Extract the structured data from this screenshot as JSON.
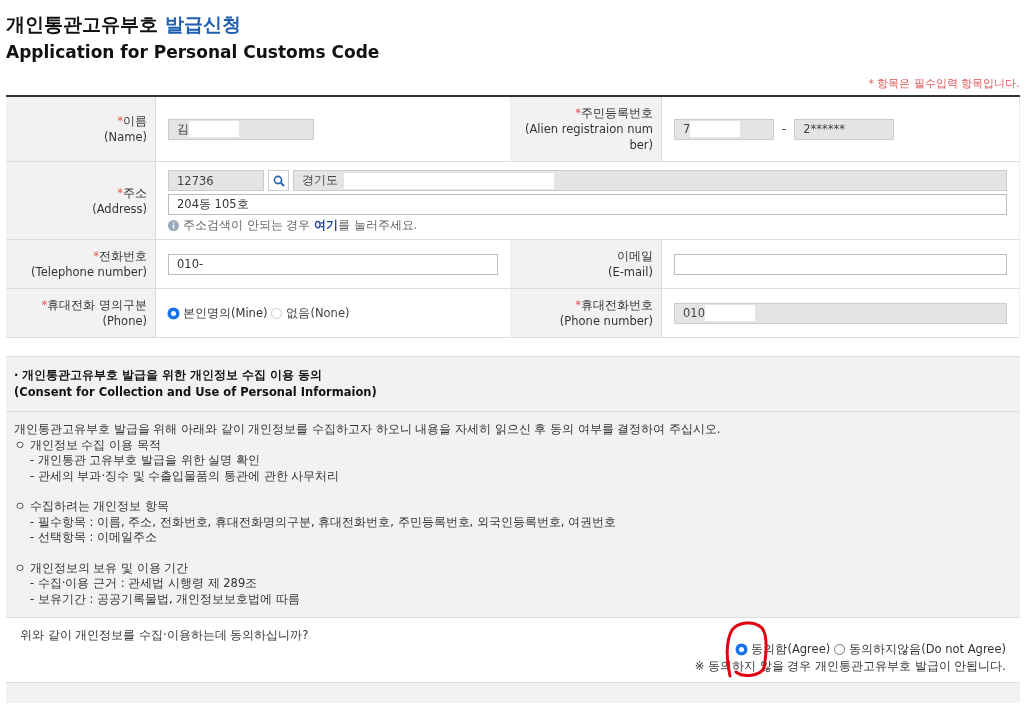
{
  "header": {
    "title": "개인통관고유부호",
    "title_highlight": "발급신청",
    "subtitle": "Application for Personal Customs Code",
    "required_note": "* 항목은 필수입력 항목입니다."
  },
  "form": {
    "required_mark": "*",
    "rows": [
      {
        "fields": [
          {
            "kind": "text",
            "label": "이름",
            "sublabel": "(Name)",
            "required": true,
            "value": "김",
            "readonly": true,
            "masked": true
          },
          {
            "kind": "id_number",
            "label": "주민등록번호",
            "sublabel": "(Alien registraion number)",
            "required": true,
            "parts": [
              {
                "value": "7",
                "masked": true
              },
              {
                "value": "2******",
                "masked": false
              }
            ],
            "separator": "-",
            "readonly": true
          }
        ]
      },
      {
        "fields": [
          {
            "kind": "address",
            "label": "주소",
            "sublabel": "(Address)",
            "required": true,
            "zip": "12736",
            "road": "경기도",
            "road_masked": true,
            "detail": "204동 105호",
            "hint_before": "주소검색이 안되는 경우 ",
            "hint_link": "여기",
            "hint_after": "를 눌러주세요."
          }
        ]
      },
      {
        "fields": [
          {
            "kind": "text",
            "label": "전화번호",
            "sublabel": "(Telephone number)",
            "required": true,
            "value": "010-",
            "readonly": false
          },
          {
            "kind": "text",
            "label": "이메일",
            "sublabel": "(E-mail)",
            "required": false,
            "readonly": false
          }
        ]
      },
      {
        "fields": [
          {
            "kind": "radio",
            "label": "휴대전화 명의구분",
            "sublabel": "(Phone)",
            "required": true,
            "options": [
              {
                "label": "본인명의(Mine)",
                "selected": true,
                "disabled": false
              },
              {
                "label": "없음(None)",
                "selected": false,
                "disabled": true
              }
            ]
          },
          {
            "kind": "text",
            "label": "휴대전화번호",
            "sublabel": "(Phone number)",
            "required": true,
            "value": "010",
            "readonly": true,
            "masked": true
          }
        ]
      }
    ]
  },
  "consent": {
    "heading": "· 개인통관고유부호 발급을 위한 개인정보 수집 이용 동의",
    "heading_en": "(Consent for Collection and Use of Personal Informaion)",
    "intro": "개인통관고유부호 발급을 위해 아래와 같이 개인정보를 수집하고자 하오니 내용을 자세히 읽으신 후 동의 여부를 결정하여 주십시오.",
    "sections": [
      {
        "title": "ㅇ 개인정보 수집 이용 목적",
        "items": [
          "- 개인통관 고유부호 발급을 위한 실명 확인",
          "- 관세의 부과·징수 및 수출입물품의 통관에 관한 사무처리"
        ]
      },
      {
        "title": "ㅇ 수집하려는 개인정보 항목",
        "items": [
          "- 필수항목 : 이름, 주소, 전화번호, 휴대전화명의구분, 휴대전화번호, 주민등록번호, 외국인등록번호, 여권번호",
          "- 선택항목 : 이메일주소"
        ]
      },
      {
        "title": "ㅇ 개인정보의 보유 및 이용 기간",
        "items": [
          "- 수집·이용 근거 : 관세법 시행령 제 289조",
          "- 보유기간 : 공공기록물법, 개인정보보호법에 따름"
        ]
      }
    ],
    "question": "위와 같이 개인정보를 수집·이용하는데 동의하십니까?",
    "options": [
      {
        "label": "동의함(Agree)",
        "selected": true
      },
      {
        "label": "동의하지않음(Do not Agree)",
        "selected": false
      }
    ],
    "note": "※ 동의하지 않을 경우 개인통관고유부호 발급이 안됩니다.",
    "annotation": {
      "kind": "circle"
    }
  }
}
